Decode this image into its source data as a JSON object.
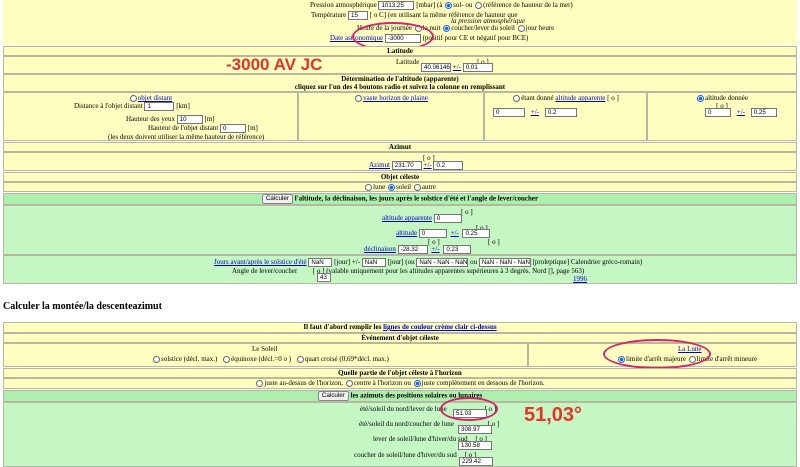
{
  "pressure": {
    "label": "Pression atmosphérique",
    "value": "1013.25",
    "unit": "[mbar] (à",
    "opt1": "sol- ou",
    "opt2": "(référence de hauteur de la mer)"
  },
  "temperature": {
    "label": "Température",
    "value": "15",
    "unit": "[ o C] (en utilisant la même référence de hauteur que",
    "note": "la pression atmosphérique"
  },
  "hour": {
    "label": "Heure de la journée",
    "opt_night": "la nuit",
    "opt_sunrise": "coucher/lever du soleil",
    "opt_day": "jour heure"
  },
  "date_astro": {
    "link": "Date astronomique",
    "value": "-3000",
    "note": "(positif pour CE et négatif pour BCE)"
  },
  "latitude": {
    "header": "Latitude",
    "label": "Latitude",
    "value": "40.06146",
    "pm": "+/-",
    "pm_value": "0.01",
    "unit": "[ o ]"
  },
  "altitude_det": {
    "header1": "Détermination de l'altitude (apparente)",
    "header2": "cliquez sur l'un des 4 boutons radio et suivez la colonne en remplissant",
    "distant_object": "objet distant",
    "distance_label": "Distance à l'objet distant",
    "distance_value": "1",
    "distance_unit": "[km]",
    "eye_height_label": "Hauteur des yeux",
    "eye_height_value": "10",
    "eye_height_unit": "[m]",
    "obj_height_label": "Hauteur de l'objet distant",
    "obj_height_value": "0",
    "obj_height_unit": "[m]",
    "obj_height_note": "(les deux doivent utiliser la même hauteur de référence)",
    "horizon": "vaste horizon de plaine",
    "given_app": "étant donné",
    "given_app_link": "altitude apparente",
    "given_app_unit": "[ o ]",
    "given_app_value": "0",
    "given_app_pm": "+/-",
    "given_app_pm_value": "0.2",
    "given_alt": "altitude donnée",
    "given_alt_unit": "[ o ]",
    "given_alt_value": "0",
    "given_alt_pm": "+/-",
    "given_alt_pm_value": "0.25"
  },
  "azimuth": {
    "header": "Azimut",
    "link": "Azimut",
    "value": "231.70",
    "pm": "+/-",
    "pm_value": "0.2",
    "unit": "[ o ]"
  },
  "celestial": {
    "header": "Objet céleste",
    "opt_moon": "lune",
    "opt_sun": "soleil",
    "opt_other": "autre"
  },
  "calc1": {
    "button": "Calculer",
    "label": "l'altitude, la déclinaison, les jours après le solstice d'été et l'angle de lever/coucher"
  },
  "results": {
    "app_alt_link": "altitude apparente",
    "app_alt_value": "0",
    "unit": "[ o ]",
    "alt_link": "altitude",
    "alt_value": "0",
    "alt_pm": "+/-",
    "alt_pm_value": "0.25",
    "decl_link": "déclinaison",
    "decl_value": "-28.32",
    "decl_pm": "+/-",
    "decl_pm_value": "0.23",
    "days_link": "Jours avant/après le solstice d'été",
    "days_value": "NaN",
    "days_mid1": "[jour] +/-",
    "days_pm_value": "NaN",
    "days_mid2": "[jour] (ou",
    "days_range1": "NaN - NaN - NaN",
    "days_mid3": "ou",
    "days_range2": "NaN - NaN - NaN",
    "days_tail": "[proleptique] Calendrier gréco-romain)",
    "angle_label": "Angle de lever/coucher",
    "angle_unit_note": "[ o ] (valable uniquement pour les altitudes apparentes supérieures à 3 degrés. Nord [",
    "angle_tail": "], page 563)",
    "angle_value": "43",
    "year_link": "1996"
  },
  "section2": {
    "title": "Calculer la montée/la descenteazimut"
  },
  "req": {
    "text": "Il faut d'abord remplir les",
    "link": "lignes de couleur crème clair ci-dessus"
  },
  "event": {
    "header": "Événement d'objet céleste",
    "sun_label": "Le Soleil",
    "solstice": "solstice (décl. max.)",
    "equinox": "équinoxe (décl.=0 o )",
    "quarter": "quart croisé (0,69*décl. max.)",
    "moon_link": "La Lune",
    "moon_major": "limite d'arrêt majeure",
    "moon_minor": "limite d'arrêt mineure"
  },
  "horizon_part": {
    "header": "Quelle partie de l'objet céleste à l'horizon",
    "opt_above": "juste au-dessus de l'horizon,",
    "opt_center": "centre à l'horizon ou",
    "opt_below": "juste complètement en dessous de l'horizon."
  },
  "calc2": {
    "button": "Calculer",
    "label": "les azimuts des positions solaires ou lunaires"
  },
  "azimuths": {
    "unit": "[ o ]",
    "r1_label": "été/soleil du nord/lever de lune",
    "r1_value": "51.03",
    "r2_label": "été/soleil du nord/coucher de lune",
    "r2_value": "308.97",
    "r3_label": "lever de soleil/lune d'hiver/du sud",
    "r3_value": "130.58",
    "r4_label": "coucher de soleil/lune d'hiver/du sud",
    "r4_value": "229.42"
  },
  "annotations": {
    "date_note": "-3000 AV JC",
    "azimuth_note": "51,03°",
    "color": "#e8332b",
    "ellipse_color": "#d8246e"
  }
}
